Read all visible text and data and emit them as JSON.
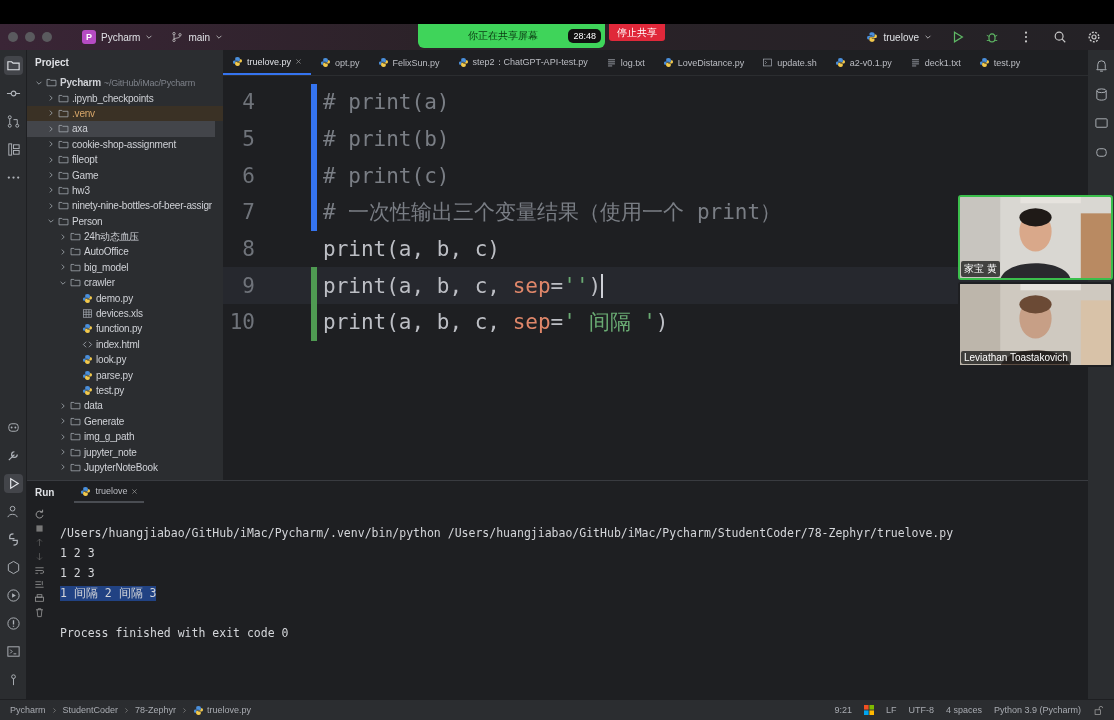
{
  "titlebar": {
    "project_badge": "P",
    "project": "Pycharm",
    "branch": "main",
    "run_config": "truelove"
  },
  "screen_share": {
    "message": "你正在共享屏幕",
    "timer": "28:48",
    "stop_button": "停止共享"
  },
  "left_toolbar": {
    "top": [
      {
        "kind": "folder",
        "selected": true
      },
      {
        "kind": "commit",
        "selected": false
      },
      {
        "kind": "pull",
        "selected": false
      },
      {
        "kind": "structure",
        "selected": false
      },
      {
        "kind": "more",
        "selected": false
      }
    ],
    "bottom": [
      {
        "kind": "packages",
        "selected": false
      },
      {
        "kind": "build",
        "selected": false
      },
      {
        "kind": "run",
        "selected": true
      },
      {
        "kind": "services",
        "selected": false
      },
      {
        "kind": "python",
        "selected": false
      },
      {
        "kind": "deploy",
        "selected": false
      },
      {
        "kind": "play",
        "selected": false
      },
      {
        "kind": "problems",
        "selected": false
      },
      {
        "kind": "terminal",
        "selected": false
      },
      {
        "kind": "git",
        "selected": false
      }
    ]
  },
  "project_panel": {
    "title": "Project",
    "tree": [
      {
        "name": "Pycharm",
        "path": "~/GitHub/iMac/Pycharm",
        "kind": "folder",
        "expanded": true,
        "selected": false,
        "children": [
          {
            "name": ".ipynb_checkpoints",
            "kind": "folder",
            "expanded": false,
            "selected": false
          },
          {
            "name": ".venv",
            "kind": "folder",
            "expanded": false,
            "selected": false,
            "excluded": true
          },
          {
            "name": "axa",
            "kind": "folder",
            "expanded": false,
            "selected": true
          },
          {
            "name": "cookie-shop-assignment",
            "kind": "folder",
            "expanded": false,
            "selected": false
          },
          {
            "name": "fileopt",
            "kind": "folder",
            "expanded": false,
            "selected": false
          },
          {
            "name": "Game",
            "kind": "folder",
            "expanded": false,
            "selected": false
          },
          {
            "name": "hw3",
            "kind": "folder",
            "expanded": false,
            "selected": false
          },
          {
            "name": "ninety-nine-bottles-of-beer-assigr",
            "kind": "folder",
            "expanded": false,
            "selected": false
          },
          {
            "name": "Person",
            "kind": "folder",
            "expanded": true,
            "selected": false,
            "children": [
              {
                "name": "24h动态血压",
                "kind": "folder",
                "expanded": false,
                "selected": false
              },
              {
                "name": "AutoOffice",
                "kind": "folder",
                "expanded": false,
                "selected": false
              },
              {
                "name": "big_model",
                "kind": "folder",
                "expanded": false,
                "selected": false
              },
              {
                "name": "crawler",
                "kind": "folder",
                "expanded": true,
                "selected": false,
                "children": [
                  {
                    "name": "demo.py",
                    "kind": "python",
                    "selected": false
                  },
                  {
                    "name": "devices.xls",
                    "kind": "sheet",
                    "selected": false
                  },
                  {
                    "name": "function.py",
                    "kind": "python",
                    "selected": false
                  },
                  {
                    "name": "index.html",
                    "kind": "html",
                    "selected": false
                  },
                  {
                    "name": "look.py",
                    "kind": "python",
                    "selected": false
                  },
                  {
                    "name": "parse.py",
                    "kind": "python",
                    "selected": false
                  },
                  {
                    "name": "test.py",
                    "kind": "python",
                    "selected": false
                  }
                ]
              },
              {
                "name": "data",
                "kind": "folder",
                "expanded": false,
                "selected": false
              },
              {
                "name": "Generate",
                "kind": "folder",
                "expanded": false,
                "selected": false
              },
              {
                "name": "img_g_path",
                "kind": "folder",
                "expanded": false,
                "selected": false
              },
              {
                "name": "jupyter_note",
                "kind": "folder",
                "expanded": false,
                "selected": false
              },
              {
                "name": "JupyterNoteBook",
                "kind": "folder",
                "expanded": false,
                "selected": false
              }
            ]
          }
        ]
      }
    ]
  },
  "editor_tabs": [
    {
      "label": "truelove.py",
      "kind": "python",
      "selected": true
    },
    {
      "label": "opt.py",
      "kind": "python",
      "selected": false
    },
    {
      "label": "FelixSun.py",
      "kind": "python",
      "selected": false
    },
    {
      "label": "step2：ChatGPT-API-test.py",
      "kind": "python",
      "selected": false
    },
    {
      "label": "log.txt",
      "kind": "text",
      "selected": false
    },
    {
      "label": "LoveDistance.py",
      "kind": "python",
      "selected": false
    },
    {
      "label": "update.sh",
      "kind": "shell",
      "selected": false
    },
    {
      "label": "a2-v0.1.py",
      "kind": "python",
      "selected": false
    },
    {
      "label": "deck1.txt",
      "kind": "text",
      "selected": false
    },
    {
      "label": "test.py",
      "kind": "python",
      "selected": false
    }
  ],
  "code": [
    {
      "number": "4",
      "kind": "modified",
      "current": false,
      "cursor": false,
      "tokens": [
        {
          "text": "# print(a)",
          "kind": "comment"
        }
      ]
    },
    {
      "number": "5",
      "kind": "modified",
      "current": false,
      "cursor": false,
      "tokens": [
        {
          "text": "# print(b)",
          "kind": "comment"
        }
      ]
    },
    {
      "number": "6",
      "kind": "modified",
      "current": false,
      "cursor": false,
      "tokens": [
        {
          "text": "# print(c)",
          "kind": "comment"
        }
      ]
    },
    {
      "number": "7",
      "kind": "modified",
      "current": false,
      "cursor": false,
      "tokens": [
        {
          "text": "# 一次性输出三个变量结果（使用一个 print）",
          "kind": "comment"
        }
      ]
    },
    {
      "number": "8",
      "kind": "unchanged",
      "current": false,
      "cursor": false,
      "tokens": [
        {
          "text": "print(a, b, c)",
          "kind": "plain"
        }
      ]
    },
    {
      "number": "9",
      "kind": "added",
      "current": true,
      "cursor": true,
      "tokens": [
        {
          "text": "print(a, b, c, ",
          "kind": "plain"
        },
        {
          "text": "sep",
          "kind": "param"
        },
        {
          "text": "=",
          "kind": "plain"
        },
        {
          "text": "''",
          "kind": "string"
        },
        {
          "text": ")",
          "kind": "plain"
        }
      ]
    },
    {
      "number": "10",
      "kind": "added",
      "current": false,
      "cursor": false,
      "tokens": [
        {
          "text": "print(a, b, c, ",
          "kind": "plain"
        },
        {
          "text": "sep",
          "kind": "param"
        },
        {
          "text": "=",
          "kind": "plain"
        },
        {
          "text": "' 间隔 '",
          "kind": "string"
        },
        {
          "text": ")",
          "kind": "plain"
        }
      ]
    }
  ],
  "video_call": [
    {
      "name": "家宝 黄",
      "speaking": true,
      "kind": "picture"
    },
    {
      "name": "Leviathan Toastakovich",
      "speaking": false,
      "kind": "picture"
    }
  ],
  "run_panel": {
    "title": "Run",
    "tab": "truelove",
    "output": [
      {
        "text": "/Users/huangjiabao/GitHub/iMac/Pycharm/.venv/bin/python /Users/huangjiabao/GitHub/iMac/Pycharm/StudentCoder/78-Zephyr/truelove.py",
        "kind": "command",
        "selected": false
      },
      {
        "text": "1 2 3",
        "kind": "stdout",
        "selected": false
      },
      {
        "text": "1 2 3",
        "kind": "stdout",
        "selected": false
      },
      {
        "text": "1 间隔 2 间隔 3",
        "kind": "stdout",
        "selected": true
      },
      {
        "text": "Process finished with exit code 0",
        "kind": "exit",
        "selected": false
      }
    ]
  },
  "status_bar": {
    "breadcrumbs": [
      {
        "label": "Pycharm",
        "kind": "project"
      },
      {
        "label": "StudentCoder",
        "kind": "folder"
      },
      {
        "label": "78-Zephyr",
        "kind": "folder"
      },
      {
        "label": "truelove.py",
        "kind": "python"
      }
    ],
    "position": "9:21",
    "line_separator": "LF",
    "encoding": "UTF-8",
    "indent": "4 spaces",
    "interpreter": "Python 3.9 (Pycharm)"
  }
}
